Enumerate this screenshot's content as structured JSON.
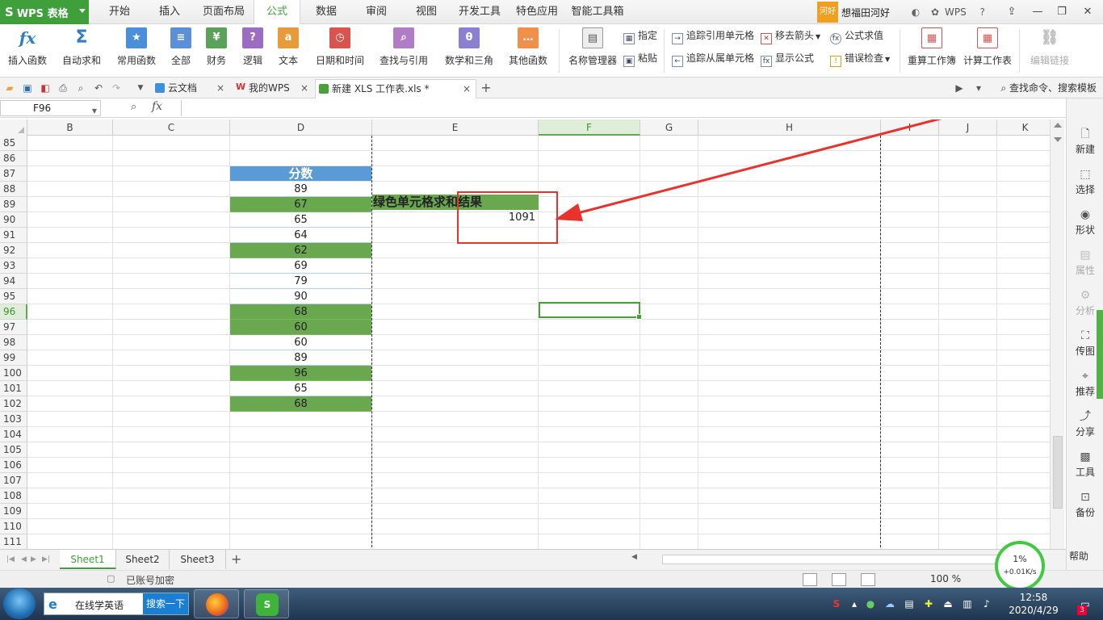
{
  "app": {
    "name": "WPS 表格"
  },
  "menu_tabs": [
    "开始",
    "插入",
    "页面布局",
    "公式",
    "数据",
    "审阅",
    "视图",
    "开发工具",
    "特色应用",
    "智能工具箱"
  ],
  "active_menu": "公式",
  "user": {
    "avatar_text": "河好",
    "name": "想福田河好"
  },
  "ribbon": {
    "insert_function": "插入函数",
    "autosum": "自动求和",
    "common_functions": "常用函数",
    "all": "全部",
    "finance": "财务",
    "logic": "逻辑",
    "text": "文本",
    "datetime": "日期和时间",
    "lookup": "查找与引用",
    "math": "数学和三角",
    "other": "其他函数",
    "name_manager": "名称管理器",
    "specify": "指定",
    "paste": "粘贴",
    "trace_precedents": "追踪引用单元格",
    "trace_dependents": "追踪从属单元格",
    "remove_arrows": "移去箭头",
    "show_formulas": "显示公式",
    "evaluate_formula": "公式求值",
    "error_check": "错误检查",
    "recalc_workbook": "重算工作簿",
    "calc_sheet": "计算工作表",
    "edit_links": "编辑链接"
  },
  "doc_tabs": [
    {
      "label": "云文档"
    },
    {
      "label": "我的WPS"
    },
    {
      "label": "新建 XLS 工作表.xls *"
    }
  ],
  "search_commands": "查找命令、搜索模板",
  "namebox": "F96",
  "columns": [
    "B",
    "C",
    "D",
    "E",
    "F",
    "G",
    "H",
    "I",
    "J",
    "K"
  ],
  "selected_column": "F",
  "rows": [
    "85",
    "86",
    "87",
    "88",
    "89",
    "90",
    "91",
    "92",
    "93",
    "94",
    "95",
    "96",
    "97",
    "98",
    "99",
    "100",
    "101",
    "102",
    "103",
    "104",
    "105",
    "106",
    "107",
    "108",
    "109",
    "110",
    "111"
  ],
  "selected_row": "96",
  "d_column": {
    "header": "分数",
    "values": [
      "89",
      "67",
      "65",
      "64",
      "62",
      "69",
      "79",
      "90",
      "68",
      "60",
      "60",
      "89",
      "96",
      "65",
      "68"
    ],
    "green": [
      false,
      true,
      false,
      false,
      true,
      false,
      false,
      false,
      true,
      true,
      false,
      false,
      true,
      false,
      true
    ]
  },
  "e89_label": "绿色单元格求和结果",
  "e90_result": "1091",
  "colors": {
    "green_cell": "#6aa84f",
    "header_blue": "#5b9bd5",
    "annotation_red": "#e8322b",
    "wps_green": "#3f9f3b"
  },
  "side_panel": [
    "新建",
    "选择",
    "形状",
    "属性",
    "分析",
    "传图",
    "推荐",
    "分享",
    "工具",
    "备份",
    "帮助"
  ],
  "sheets": [
    "Sheet1",
    "Sheet2",
    "Sheet3"
  ],
  "active_sheet": "Sheet1",
  "status": {
    "text": "已账号加密",
    "zoom": "100 %"
  },
  "speed_widget": {
    "pct": "1%",
    "speed": "+0.01K/s"
  },
  "taskbar": {
    "ie_text": "在线学英语",
    "ie_button": "搜索一下"
  },
  "clock": {
    "time": "12:58",
    "date": "2020/4/29"
  },
  "notification_count": "3"
}
